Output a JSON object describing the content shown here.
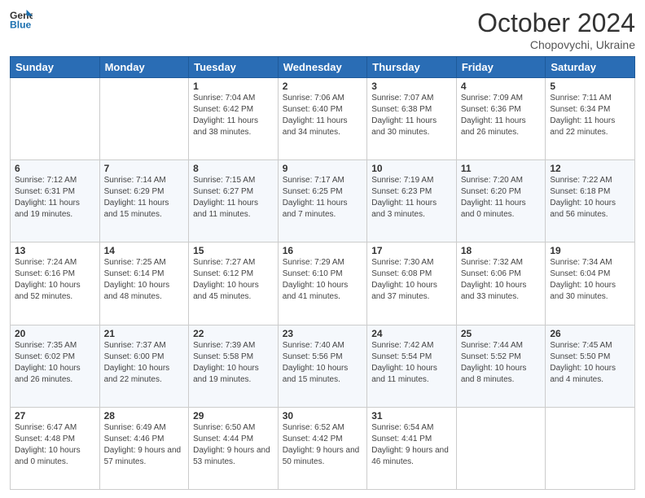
{
  "header": {
    "logo_general": "General",
    "logo_blue": "Blue",
    "month_title": "October 2024",
    "subtitle": "Chopovychi, Ukraine"
  },
  "weekdays": [
    "Sunday",
    "Monday",
    "Tuesday",
    "Wednesday",
    "Thursday",
    "Friday",
    "Saturday"
  ],
  "weeks": [
    [
      {
        "day": "",
        "sunrise": "",
        "sunset": "",
        "daylight": ""
      },
      {
        "day": "",
        "sunrise": "",
        "sunset": "",
        "daylight": ""
      },
      {
        "day": "1",
        "sunrise": "Sunrise: 7:04 AM",
        "sunset": "Sunset: 6:42 PM",
        "daylight": "Daylight: 11 hours and 38 minutes."
      },
      {
        "day": "2",
        "sunrise": "Sunrise: 7:06 AM",
        "sunset": "Sunset: 6:40 PM",
        "daylight": "Daylight: 11 hours and 34 minutes."
      },
      {
        "day": "3",
        "sunrise": "Sunrise: 7:07 AM",
        "sunset": "Sunset: 6:38 PM",
        "daylight": "Daylight: 11 hours and 30 minutes."
      },
      {
        "day": "4",
        "sunrise": "Sunrise: 7:09 AM",
        "sunset": "Sunset: 6:36 PM",
        "daylight": "Daylight: 11 hours and 26 minutes."
      },
      {
        "day": "5",
        "sunrise": "Sunrise: 7:11 AM",
        "sunset": "Sunset: 6:34 PM",
        "daylight": "Daylight: 11 hours and 22 minutes."
      }
    ],
    [
      {
        "day": "6",
        "sunrise": "Sunrise: 7:12 AM",
        "sunset": "Sunset: 6:31 PM",
        "daylight": "Daylight: 11 hours and 19 minutes."
      },
      {
        "day": "7",
        "sunrise": "Sunrise: 7:14 AM",
        "sunset": "Sunset: 6:29 PM",
        "daylight": "Daylight: 11 hours and 15 minutes."
      },
      {
        "day": "8",
        "sunrise": "Sunrise: 7:15 AM",
        "sunset": "Sunset: 6:27 PM",
        "daylight": "Daylight: 11 hours and 11 minutes."
      },
      {
        "day": "9",
        "sunrise": "Sunrise: 7:17 AM",
        "sunset": "Sunset: 6:25 PM",
        "daylight": "Daylight: 11 hours and 7 minutes."
      },
      {
        "day": "10",
        "sunrise": "Sunrise: 7:19 AM",
        "sunset": "Sunset: 6:23 PM",
        "daylight": "Daylight: 11 hours and 3 minutes."
      },
      {
        "day": "11",
        "sunrise": "Sunrise: 7:20 AM",
        "sunset": "Sunset: 6:20 PM",
        "daylight": "Daylight: 11 hours and 0 minutes."
      },
      {
        "day": "12",
        "sunrise": "Sunrise: 7:22 AM",
        "sunset": "Sunset: 6:18 PM",
        "daylight": "Daylight: 10 hours and 56 minutes."
      }
    ],
    [
      {
        "day": "13",
        "sunrise": "Sunrise: 7:24 AM",
        "sunset": "Sunset: 6:16 PM",
        "daylight": "Daylight: 10 hours and 52 minutes."
      },
      {
        "day": "14",
        "sunrise": "Sunrise: 7:25 AM",
        "sunset": "Sunset: 6:14 PM",
        "daylight": "Daylight: 10 hours and 48 minutes."
      },
      {
        "day": "15",
        "sunrise": "Sunrise: 7:27 AM",
        "sunset": "Sunset: 6:12 PM",
        "daylight": "Daylight: 10 hours and 45 minutes."
      },
      {
        "day": "16",
        "sunrise": "Sunrise: 7:29 AM",
        "sunset": "Sunset: 6:10 PM",
        "daylight": "Daylight: 10 hours and 41 minutes."
      },
      {
        "day": "17",
        "sunrise": "Sunrise: 7:30 AM",
        "sunset": "Sunset: 6:08 PM",
        "daylight": "Daylight: 10 hours and 37 minutes."
      },
      {
        "day": "18",
        "sunrise": "Sunrise: 7:32 AM",
        "sunset": "Sunset: 6:06 PM",
        "daylight": "Daylight: 10 hours and 33 minutes."
      },
      {
        "day": "19",
        "sunrise": "Sunrise: 7:34 AM",
        "sunset": "Sunset: 6:04 PM",
        "daylight": "Daylight: 10 hours and 30 minutes."
      }
    ],
    [
      {
        "day": "20",
        "sunrise": "Sunrise: 7:35 AM",
        "sunset": "Sunset: 6:02 PM",
        "daylight": "Daylight: 10 hours and 26 minutes."
      },
      {
        "day": "21",
        "sunrise": "Sunrise: 7:37 AM",
        "sunset": "Sunset: 6:00 PM",
        "daylight": "Daylight: 10 hours and 22 minutes."
      },
      {
        "day": "22",
        "sunrise": "Sunrise: 7:39 AM",
        "sunset": "Sunset: 5:58 PM",
        "daylight": "Daylight: 10 hours and 19 minutes."
      },
      {
        "day": "23",
        "sunrise": "Sunrise: 7:40 AM",
        "sunset": "Sunset: 5:56 PM",
        "daylight": "Daylight: 10 hours and 15 minutes."
      },
      {
        "day": "24",
        "sunrise": "Sunrise: 7:42 AM",
        "sunset": "Sunset: 5:54 PM",
        "daylight": "Daylight: 10 hours and 11 minutes."
      },
      {
        "day": "25",
        "sunrise": "Sunrise: 7:44 AM",
        "sunset": "Sunset: 5:52 PM",
        "daylight": "Daylight: 10 hours and 8 minutes."
      },
      {
        "day": "26",
        "sunrise": "Sunrise: 7:45 AM",
        "sunset": "Sunset: 5:50 PM",
        "daylight": "Daylight: 10 hours and 4 minutes."
      }
    ],
    [
      {
        "day": "27",
        "sunrise": "Sunrise: 6:47 AM",
        "sunset": "Sunset: 4:48 PM",
        "daylight": "Daylight: 10 hours and 0 minutes."
      },
      {
        "day": "28",
        "sunrise": "Sunrise: 6:49 AM",
        "sunset": "Sunset: 4:46 PM",
        "daylight": "Daylight: 9 hours and 57 minutes."
      },
      {
        "day": "29",
        "sunrise": "Sunrise: 6:50 AM",
        "sunset": "Sunset: 4:44 PM",
        "daylight": "Daylight: 9 hours and 53 minutes."
      },
      {
        "day": "30",
        "sunrise": "Sunrise: 6:52 AM",
        "sunset": "Sunset: 4:42 PM",
        "daylight": "Daylight: 9 hours and 50 minutes."
      },
      {
        "day": "31",
        "sunrise": "Sunrise: 6:54 AM",
        "sunset": "Sunset: 4:41 PM",
        "daylight": "Daylight: 9 hours and 46 minutes."
      },
      {
        "day": "",
        "sunrise": "",
        "sunset": "",
        "daylight": ""
      },
      {
        "day": "",
        "sunrise": "",
        "sunset": "",
        "daylight": ""
      }
    ]
  ]
}
